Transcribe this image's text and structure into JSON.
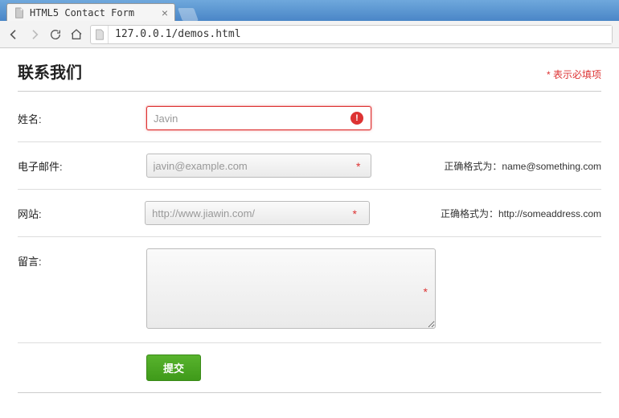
{
  "browser": {
    "tab_title": "HTML5 Contact Form",
    "url": "127.0.0.1/demos.html"
  },
  "header": {
    "title": "联系我们",
    "required_hint": "* 表示必填项"
  },
  "fields": {
    "name": {
      "label": "姓名:",
      "placeholder": "Javin",
      "value": "",
      "error": true
    },
    "email": {
      "label": "电子邮件:",
      "placeholder": "javin@example.com",
      "value": "",
      "hint": "正确格式为：name@something.com"
    },
    "website": {
      "label": "网站:",
      "placeholder": "http://www.jiawin.com/",
      "value": "",
      "hint": "正确格式为：http://someaddress.com"
    },
    "message": {
      "label": "留言:",
      "placeholder": "",
      "value": ""
    }
  },
  "actions": {
    "submit_label": "提交"
  }
}
